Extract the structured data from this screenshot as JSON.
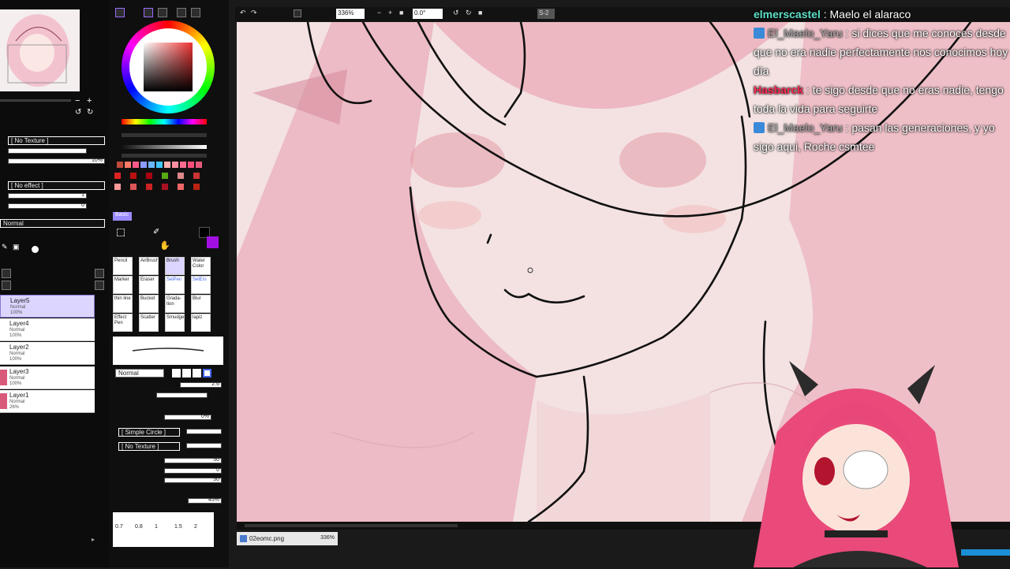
{
  "layers": [
    {
      "name": "Layer5",
      "mode": "Normal",
      "opacity": "100%",
      "selected": true
    },
    {
      "name": "Layer4",
      "mode": "Normal",
      "opacity": "100%",
      "selected": false
    },
    {
      "name": "Layer2",
      "mode": "Normal",
      "opacity": "100%",
      "selected": false
    },
    {
      "name": "Layer3",
      "mode": "Normal",
      "opacity": "100%",
      "selected": false
    },
    {
      "name": "Layer1",
      "mode": "Normal",
      "opacity": "26%",
      "selected": false
    }
  ],
  "left_panel": {
    "texture": "[ No Texture ]",
    "texture_value": "10%",
    "effect": "[ No effect ]",
    "effect_v1": "1",
    "effect_v2": "0",
    "blend": "Normal"
  },
  "tools_panel": {
    "palette_tab": "Basic",
    "tools": [
      {
        "label": "Pencil",
        "selected": false,
        "blue": false
      },
      {
        "label": "AirBrush",
        "selected": false,
        "blue": false
      },
      {
        "label": "Brush",
        "selected": true,
        "blue": false
      },
      {
        "label": "Water Color",
        "selected": false,
        "blue": false
      },
      {
        "label": "Marker",
        "selected": false,
        "blue": false
      },
      {
        "label": "Eraser",
        "selected": false,
        "blue": false
      },
      {
        "label": "SelPen",
        "selected": false,
        "blue": true
      },
      {
        "label": "SelErs",
        "selected": false,
        "blue": true
      },
      {
        "label": "thin line",
        "selected": false,
        "blue": false
      },
      {
        "label": "Bucket",
        "selected": false,
        "blue": false
      },
      {
        "label": "Grada-tion",
        "selected": false,
        "blue": false
      },
      {
        "label": "Blur",
        "selected": false,
        "blue": false
      },
      {
        "label": "Effect Pen",
        "selected": false,
        "blue": false
      },
      {
        "label": "Scatter",
        "selected": false,
        "blue": false
      },
      {
        "label": "Smudge",
        "selected": false,
        "blue": false
      },
      {
        "label": "lapiz",
        "selected": false,
        "blue": false
      }
    ],
    "blend_mode": "Normal",
    "brush_size": "2.6",
    "density": "0%",
    "shape": "[ Simple Circle ]",
    "texture": "[ No Texture ]",
    "v50a": "50",
    "v0": "0",
    "v50b": "50",
    "pressure": "45%",
    "size_presets": [
      "0.7",
      "0.8",
      "1",
      "1.5",
      "2"
    ],
    "swatch_colors": [
      "#c14a3a",
      "#ff7a6a",
      "#ff5a8a",
      "#8a9aff",
      "#6ab7ff",
      "#41c5ff",
      "#ffb0b0",
      "#ff8fa3",
      "#ff6b8e",
      "#ff4d7a",
      "#e85a7a"
    ],
    "grid_colors": [
      "#d22",
      "#b11",
      "#a01",
      "#5a1",
      "#d88",
      "#c33",
      "#f99",
      "#d55",
      "#c22",
      "#a12",
      "#e66",
      "#b21"
    ]
  },
  "toolbar": {
    "zoom": "336%",
    "rotation": "0.0°",
    "stabilizer": "S-2"
  },
  "file_tab": {
    "name": "02eomc.png",
    "zoom": "336%"
  },
  "chat": [
    {
      "user": "elmerscastel",
      "style": "green",
      "badge": false,
      "message": "Maelo el alaraco"
    },
    {
      "user": "El_Maelo_Yaru",
      "style": "dim",
      "badge": true,
      "message": "si dices que me conoces desde que no era nadie perfectamente nos conocimos hoy día"
    },
    {
      "user": "Hasbarck",
      "style": "red",
      "badge": false,
      "message": "te sigo desde que no eras nadie, tengo toda la vida para seguirte"
    },
    {
      "user": "El_Maelo_Yaru",
      "style": "dim",
      "badge": true,
      "message": "pasan las generaciones, y yo sigo aqui, Roche csmtee"
    }
  ],
  "colors": {
    "canvas_bg": "#f3e3e3",
    "accent": "#dcd5ff",
    "hair": "#e9a7b4",
    "line": "#111111"
  }
}
